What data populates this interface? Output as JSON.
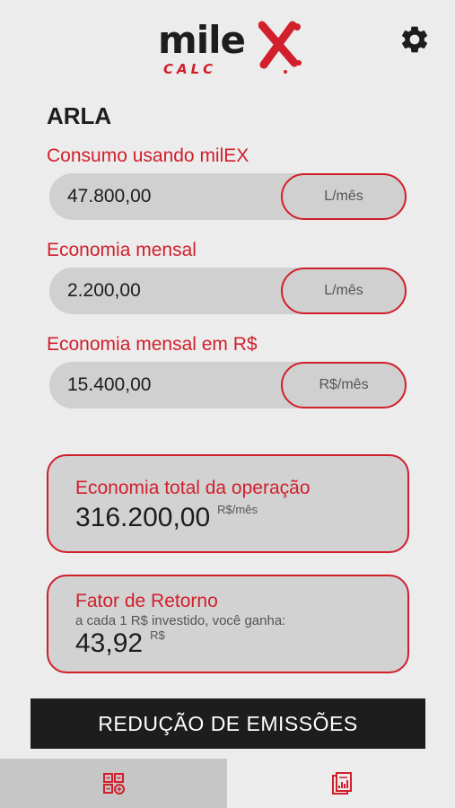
{
  "header": {
    "logo_word": "mile",
    "logo_sub": "CALC",
    "settings_icon": "gear-icon"
  },
  "page_title": "ARLA",
  "fields": [
    {
      "label": "Consumo usando milEX",
      "value": "47.800,00",
      "unit": "L/mês"
    },
    {
      "label": "Economia mensal",
      "value": "2.200,00",
      "unit": "L/mês"
    },
    {
      "label": "Economia mensal em R$",
      "value": "15.400,00",
      "unit": "R$/mês"
    }
  ],
  "total_card": {
    "title": "Economia total da operação",
    "value": "316.200,00",
    "unit": "R$/mês"
  },
  "return_card": {
    "title": "Fator de Retorno",
    "subtitle": "a cada 1 R$ investido, você ganha:",
    "value": "43,92",
    "unit": "R$"
  },
  "cta": {
    "label": "REDUÇÃO DE EMISSÕES"
  },
  "bottom_nav": {
    "tabs": [
      {
        "icon": "calculator-icon",
        "active": true
      },
      {
        "icon": "report-icon",
        "active": false
      }
    ]
  },
  "colors": {
    "accent": "#d11f2b",
    "dark": "#1d1d1d",
    "background": "#ececec",
    "field": "#d0d0d0"
  }
}
